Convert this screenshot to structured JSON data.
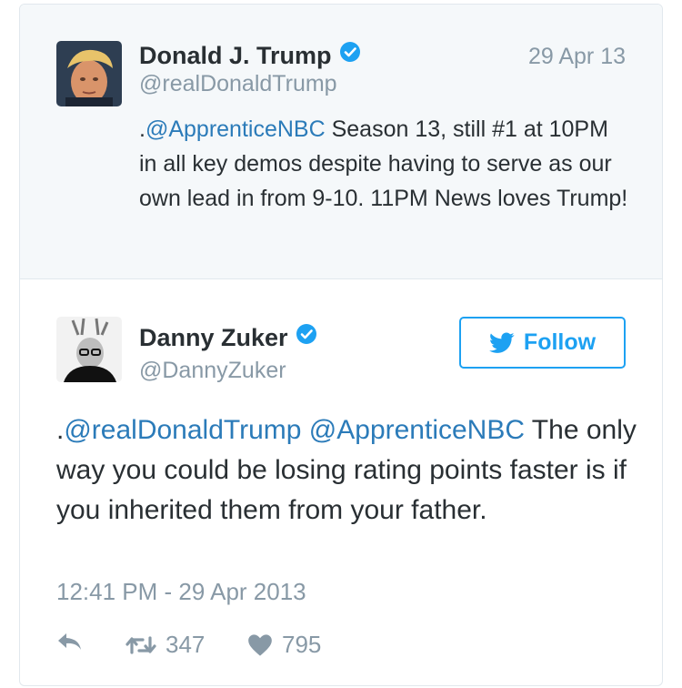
{
  "quoted_tweet": {
    "author_name": "Donald J. Trump",
    "handle": "@realDonaldTrump",
    "date": "29 Apr 13",
    "text_prefix": ".",
    "mention": "@ApprenticeNBC",
    "text_body": " Season 13, still #1 at 10PM in all key demos despite having to serve as our own lead in from 9-10. 11PM News loves Trump!",
    "verified_icon": "verified-badge-icon"
  },
  "main_tweet": {
    "author_name": "Danny Zuker",
    "handle": "@DannyZuker",
    "follow_label": "Follow",
    "text_prefix": ".",
    "mention_1": "@realDonaldTrump",
    "mention_2": "@ApprenticeNBC",
    "text_body": " The only way you could be losing rating points faster is if you inherited them from your father.",
    "timestamp": "12:41 PM - 29 Apr 2013",
    "retweet_count": "347",
    "like_count": "795"
  },
  "colors": {
    "accent": "#1da1f2",
    "link": "#2b7bb9",
    "muted": "#8899a6",
    "text": "#292f33",
    "quoted_bg": "#f5f8fa"
  }
}
